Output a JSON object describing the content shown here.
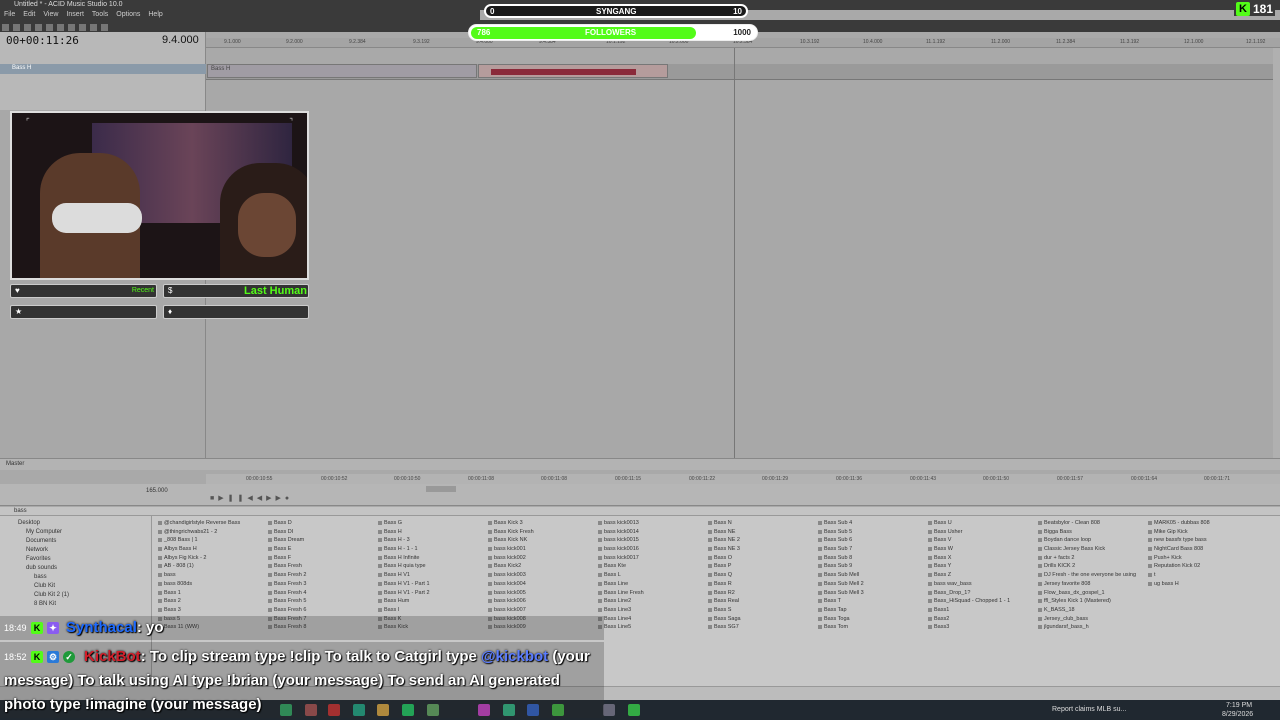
{
  "window": {
    "title": "Untitled * - ACID Music Studio 10.0"
  },
  "menu": [
    "File",
    "Edit",
    "View",
    "Insert",
    "Tools",
    "Options",
    "Help"
  ],
  "transport": {
    "time": "00+00:11:26",
    "tempo": "9.4.000"
  },
  "ruler_ticks": [
    "9.1.000",
    "9.2.000",
    "9.2.384",
    "9.3.192",
    "9.4.000",
    "9.4.384",
    "10.1.192",
    "10.2.000",
    "10.2.384",
    "10.3.192",
    "10.4.000",
    "11.1.192",
    "11.2.000",
    "11.2.384",
    "11.3.192",
    "12.1.000",
    "12.1.192",
    "12.1.384"
  ],
  "tracks": [
    {
      "label": "Bass H",
      "clip_label": "Bass H"
    }
  ],
  "mixer": {
    "label": "Master"
  },
  "lower_ruler_ticks": [
    "00:00:10:55",
    "00:00:10:52",
    "00:00:10:50",
    "00:00:11:08",
    "00:00:11:08",
    "00:00:11:15",
    "00:00:11:22",
    "00:00:11:29",
    "00:00:11:36",
    "00:00:11:43",
    "00:00:11:50",
    "00:00:11:57",
    "00:00:11:64",
    "00:00:11:71"
  ],
  "lower_bpm": "165.000",
  "explorer": {
    "path": "bass",
    "tree": [
      "Desktop",
      "My Computer",
      "Documents",
      "Network",
      "Favorites",
      "dub sounds",
      "bass",
      "Club Kit",
      "Club Kit 2 (1)",
      "8 BN Kit"
    ],
    "columns": [
      [
        "@chandigirlstyle Reverse Bass",
        "@thingrichwabs21 - 2",
        "_808 Bass | 1",
        "Albys Bass H",
        "Albys Fig Kick - 2",
        "AB - 808 (1)",
        "bass",
        "bass 808ds",
        "Bass 1",
        "Bass 2",
        "Bass 3",
        "bass 5",
        "Bass 11 (WW)"
      ],
      [
        "Bass D",
        "Bass DI",
        "Bass Dream",
        "Bass E",
        "Bass F",
        "Bass Fresh",
        "Bass Fresh 2",
        "Bass Fresh 3",
        "Bass Fresh 4",
        "Bass Fresh 5",
        "Bass Fresh 6",
        "Bass Fresh 7",
        "Bass Fresh 8"
      ],
      [
        "Bass G",
        "Bass H",
        "Bass H - 3",
        "Bass H - 1 - 1",
        "Bass H Infinite",
        "Bass H quia type",
        "Bass H V1",
        "Bass H V1 - Part 1",
        "Bass H V1 - Part 2",
        "Bass Hum",
        "Bass I",
        "Bass K",
        "Bass Kick"
      ],
      [
        "Bass Kick 3",
        "Bass Kick Fresh",
        "Bass Kick NK",
        "bass kick001",
        "bass kick002",
        "Bass Kick2",
        "bass kick003",
        "bass kick004",
        "bass kick005",
        "bass kick006",
        "bass kick007",
        "bass kick008",
        "bass kick009"
      ],
      [
        "bass kick0013",
        "bass kick0014",
        "bass kick0015",
        "bass kick0016",
        "bass kick0017",
        "Bass Kte",
        "Bass L",
        "Bass Line",
        "Bass Line Fresh",
        "Bass Line2",
        "Bass Line3",
        "Bass Line4",
        "Bass Line5"
      ],
      [
        "Bass N",
        "Bass NE",
        "Bass NE 2",
        "Bass NE 3",
        "Bass O",
        "Bass P",
        "Bass Q",
        "Bass R",
        "Bass R2",
        "Bass Real",
        "Bass S",
        "Bass Saga",
        "Bass SG7"
      ],
      [
        "Bass Sub 4",
        "Bass Sub 5",
        "Bass Sub 6",
        "Bass Sub 7",
        "Bass Sub 8",
        "Bass Sub 9",
        "Bass Sub Mell",
        "Bass Sub Mell 2",
        "Bass Sub Mell 3",
        "Bass T",
        "Bass Tap",
        "Bass Toga",
        "Bass Tom"
      ],
      [
        "Bass U",
        "Bass Usher",
        "Bass V",
        "Bass W",
        "Bass X",
        "Bass Y",
        "Bass Z",
        "bass wav_bass",
        "Bass_Drop_1?",
        "Bass_HiSquad - Chopped 1 - 1",
        "Bass1",
        "Bass2",
        "Bass3"
      ],
      [
        "Beatsbylor - Clean 808",
        "Bigga Bass",
        "Boydan dance loop",
        "Classic Jersey Bass Kick",
        "dur + facts 2",
        "Drills KICK 2",
        "DJ Fresh - the one everyone be using",
        "Jersey favorite 808",
        "Flow_bass_dx_gospel_1",
        "ffl_Styles Kick 1 (Mastered)",
        "K_BASS_18",
        "Jersey_club_bass",
        "jlgundarsf_bass_h"
      ],
      [
        "MARK05 - dubbas 808",
        "Mike Gip Kick",
        "new bassfx type bass",
        "NightCard Bass 808",
        "Push+ Kick",
        "Reputation Kick 02",
        "t",
        "ug bass H"
      ]
    ]
  },
  "stream": {
    "goal": {
      "label": "SYNGANG",
      "current": "0",
      "target": "10"
    },
    "followers": {
      "label": "FOLLOWERS",
      "current": "786",
      "target": "1000",
      "progress": 0.786
    },
    "viewer_count": "181",
    "widgets": {
      "recent": "Recent",
      "last_human": "Last Human Bi"
    }
  },
  "chat": [
    {
      "time": "18:49",
      "user": "Synthacal",
      "text": ": yo"
    },
    {
      "time": "18:52",
      "user": "KickBot",
      "line1": ": To clip stream type !clip To talk to Catgirl type ",
      "mention": "@kickbot",
      "line1_end": " (your",
      "line2": "message) To talk using AI type !brian (your message) To send an AI generated",
      "line3": "photo type !imagine (your message)"
    }
  ],
  "taskbar": {
    "news": "Report claims MLB su...",
    "time": "7:19 PM",
    "date": "8/29/2026"
  },
  "colors": {
    "kick_green": "#53fc18",
    "daw_bg": "#a9a9a9",
    "clip_wave": "#8a2a3a"
  }
}
